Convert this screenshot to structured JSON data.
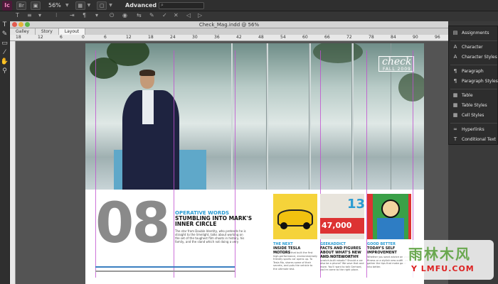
{
  "app": {
    "icon_text": "Ic",
    "zoom": "56%",
    "workspace": "Advanced",
    "search_placeholder": ""
  },
  "document": {
    "title": "Check_Mag.indd @ 56%",
    "tabs": [
      "Galley",
      "Story",
      "Layout"
    ]
  },
  "ruler_marks": [
    "18",
    "12",
    "6",
    "0",
    "6",
    "12",
    "18",
    "24",
    "30",
    "36",
    "42",
    "48",
    "54",
    "60",
    "66",
    "72",
    "78",
    "84",
    "90",
    "96"
  ],
  "panel": {
    "items": [
      {
        "icon": "assignments-icon",
        "label": "Assignments"
      },
      {
        "icon": "character-icon",
        "label": "Character"
      },
      {
        "icon": "character-styles-icon",
        "label": "Character Styles"
      },
      {
        "icon": "paragraph-icon",
        "label": "Paragraph"
      },
      {
        "icon": "paragraph-styles-icon",
        "label": "Paragraph Styles"
      },
      {
        "icon": "table-icon",
        "label": "Table"
      },
      {
        "icon": "table-styles-icon",
        "label": "Table Styles"
      },
      {
        "icon": "cell-styles-icon",
        "label": "Cell Styles"
      },
      {
        "icon": "hyperlinks-icon",
        "label": "Hyperlinks"
      },
      {
        "icon": "conditional-text-icon",
        "label": "Conditional Text"
      }
    ]
  },
  "spread": {
    "logo": {
      "title": "check",
      "subtitle": "FALL 2009"
    },
    "page_number": "08",
    "kicker": "OPERATIVE WORDS",
    "headline": "STUMBLING INTO MARK'S INNER CIRCLE",
    "body": "The star from Double Identity, who pretends he is straight to the limelight, talks about working on the set of the toughest film shoots in history, his family, and the sland which not doing a very",
    "thumbs": [
      {
        "title": "THE NEXT",
        "head": "INSIDE TESLA MOTORS",
        "body": "The company that built the first high-performance, environmentally friendly sports car opens up. To Tesla Mo, shares some of their secrets, and puts the vehicle to the ultimate test."
      },
      {
        "title": "GEEKADDICT",
        "head": "FACTS AND FIGURES ABOUT WHAT'S NEW AND NOTEWORTHY",
        "body": "How much would you pay for a scratch-built robotic? Should a car also be a phone? We save that and more. You'll want to talk Gerhard, you're come to the right place."
      },
      {
        "title": "GOOD BETTER",
        "head": "TODAY'S SELF IMPROVEMENT",
        "body": "Whether you want advice on your fitness or a stylish new outfit, we gather the tips that make good into better."
      }
    ],
    "thumb_numbers": [
      "47,000",
      "13"
    ]
  },
  "watermark": {
    "cn": "雨林木风",
    "url": "Y LMFU.COM"
  }
}
